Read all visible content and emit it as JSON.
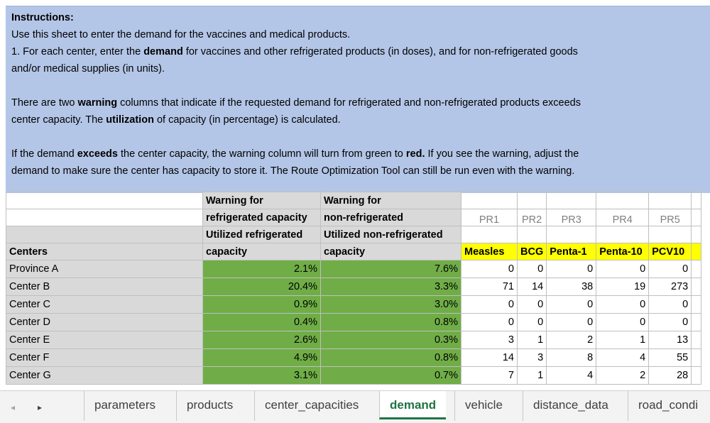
{
  "instructions": {
    "heading": "Instructions:",
    "line1": "Use this sheet to enter the demand for the vaccines and medical products.",
    "line2_a": "1. For each center, enter the ",
    "line2_b": "demand",
    "line2_c": " for vaccines and other refrigerated products (in doses), and for non-refrigerated goods",
    "line3": "and/or medical supplies (in units).",
    "line4_a": "There are two ",
    "line4_b": "warning",
    "line4_c": " columns that indicate if the requested demand for refrigerated and non-refrigerated products exceeds",
    "line5_a": "center capacity. The ",
    "line5_b": "utilization",
    "line5_c": " of capacity (in percentage) is calculated.",
    "line6_a": "If the demand ",
    "line6_b": "exceeds",
    "line6_c": " the center capacity, the warning column will turn from green to ",
    "line6_d": "red.",
    "line6_e": " If you see the warning, adjust the",
    "line7": "demand to make sure the center has capacity to store it. The Route Optimization Tool can still be run even with the warning."
  },
  "headers": {
    "warn_ref_1": "Warning for",
    "warn_ref_2": "refrigerated capacity",
    "warn_non_1": "Warning for",
    "warn_non_2": "non-refrigerated",
    "util_ref_1": "Utilized refrigerated",
    "util_ref_2": "capacity",
    "util_non_1": "Utilized non-refrigerated",
    "util_non_2": "capacity",
    "centers": "Centers",
    "pr_codes": [
      "PR1",
      "PR2",
      "PR3",
      "PR4",
      "PR5"
    ],
    "products": [
      "Measles",
      "BCG",
      "Penta-1",
      "Penta-10",
      "PCV10"
    ]
  },
  "rows": [
    {
      "center": "Province A",
      "ref": "2.1%",
      "non": "7.6%",
      "vals": [
        "0",
        "0",
        "0",
        "0",
        "0"
      ]
    },
    {
      "center": "Center B",
      "ref": "20.4%",
      "non": "3.3%",
      "vals": [
        "71",
        "14",
        "38",
        "19",
        "273"
      ]
    },
    {
      "center": "Center C",
      "ref": "0.9%",
      "non": "3.0%",
      "vals": [
        "0",
        "0",
        "0",
        "0",
        "0"
      ]
    },
    {
      "center": "Center D",
      "ref": "0.4%",
      "non": "0.8%",
      "vals": [
        "0",
        "0",
        "0",
        "0",
        "0"
      ]
    },
    {
      "center": "Center E",
      "ref": "2.6%",
      "non": "0.3%",
      "vals": [
        "3",
        "1",
        "2",
        "1",
        "13"
      ]
    },
    {
      "center": "Center F",
      "ref": "4.9%",
      "non": "0.8%",
      "vals": [
        "14",
        "3",
        "8",
        "4",
        "55"
      ]
    },
    {
      "center": "Center G",
      "ref": "3.1%",
      "non": "0.7%",
      "vals": [
        "7",
        "1",
        "4",
        "2",
        "28"
      ]
    }
  ],
  "tabs": {
    "nav_prev_icon": "◂",
    "nav_next_icon": "▸",
    "items": [
      "parameters",
      "products",
      "center_capacities",
      "demand",
      "vehicle",
      "distance_data",
      "road_condi"
    ],
    "active": "demand"
  },
  "colors": {
    "instructions_bg": "#b4c6e7",
    "status_ok": "#70ad47",
    "product_header": "#ffff00",
    "active_tab": "#217346"
  }
}
